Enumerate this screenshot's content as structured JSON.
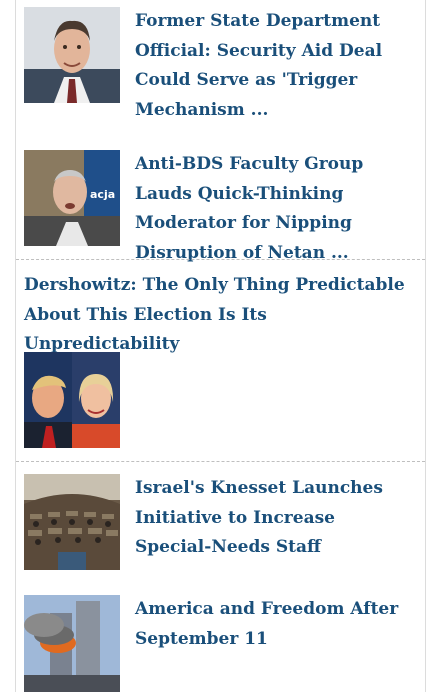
{
  "articles": [
    {
      "title": "Former State Department Official: Security Aid Deal Could Serve as 'Trigger Mechanism ...",
      "image": "portrait-man-smiling"
    },
    {
      "title": "Anti-BDS Faculty Group Lauds Quick-Thinking Moderator for Nipping Disruption of Netan ...",
      "image": "portrait-older-man-speaking"
    },
    {
      "title": "Dershowitz: The Only Thing Predictable About This Election Is Its Unpredictability",
      "image": "two-candidates-photo"
    },
    {
      "title": "Israel's Knesset Launches Initiative to Increase Special-Needs Staff",
      "image": "parliament-chamber-photo"
    },
    {
      "title": "America and Freedom After September 11",
      "image": "burning-tower-photo"
    }
  ],
  "colors": {
    "link": "#1a4f7a",
    "divider": "#bfbfbf",
    "border": "#dcdcdc"
  }
}
